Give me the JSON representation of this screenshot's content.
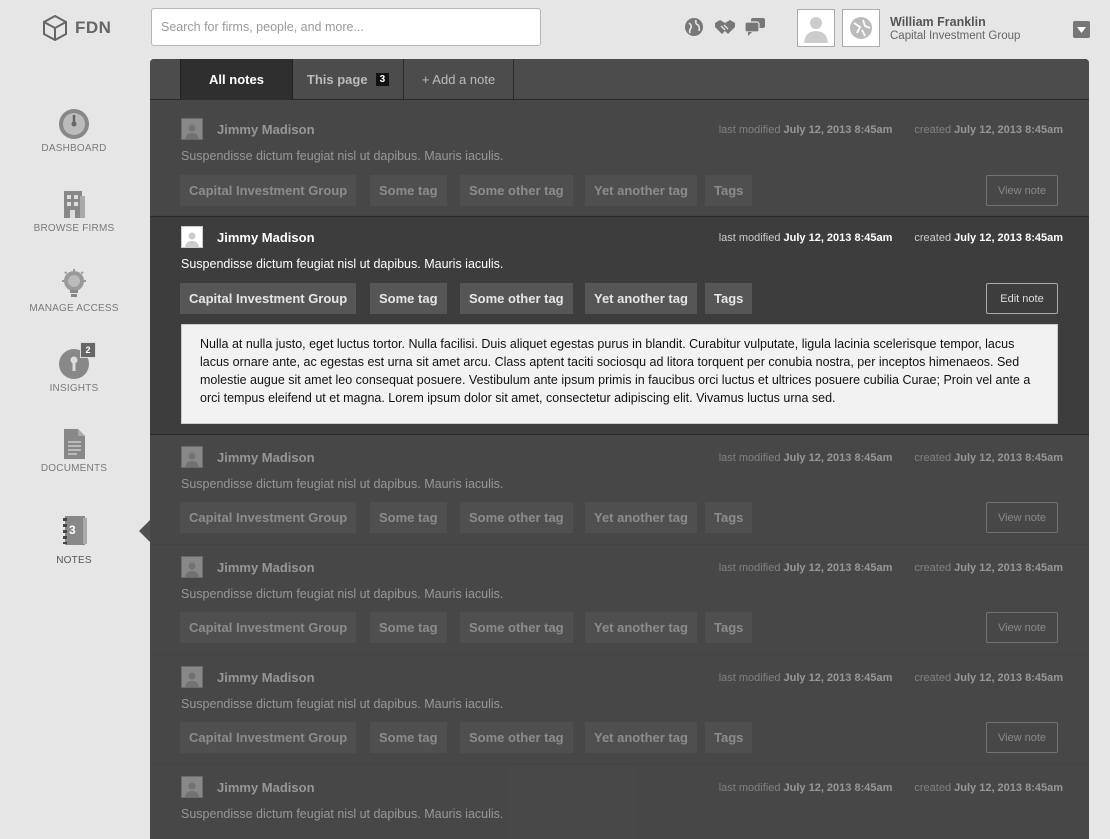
{
  "app": {
    "logo_text": "FDN"
  },
  "search": {
    "placeholder": "Search for firms, people, and more..."
  },
  "top_icons": [
    "globe-icon",
    "handshake-icon",
    "chat-icon"
  ],
  "user": {
    "name": "William Franklin",
    "organization": "Capital Investment Group"
  },
  "sidebar": {
    "items": [
      {
        "label": "DASHBOARD",
        "icon": "dashboard-icon"
      },
      {
        "label": "BROWSE FIRMS",
        "icon": "building-icon"
      },
      {
        "label": "MANAGE ACCESS",
        "icon": "lightbulb-icon"
      },
      {
        "label": "INSIGHTS",
        "icon": "insight-icon",
        "badge": "2"
      },
      {
        "label": "DOCUMENTS",
        "icon": "document-icon"
      },
      {
        "label": "NOTES",
        "icon": "notebook-icon",
        "badge": "3",
        "active": true
      }
    ]
  },
  "tabs": [
    {
      "label": "All notes",
      "active": true
    },
    {
      "label": "This page",
      "count": "3"
    },
    {
      "label": "+ Add a note"
    }
  ],
  "notes": [
    {
      "author": "Jimmy Madison",
      "modified_label": "last modified",
      "modified": "July 12, 2013 8:45am",
      "created_label": "created",
      "created": "July 12, 2013 8:45am",
      "summary": "Suspendisse dictum feugiat nisl ut dapibus. Mauris iaculis.",
      "tags": [
        "Capital Investment Group",
        "Some tag",
        "Some other tag",
        "Yet another tag",
        "Tags"
      ],
      "button": "View note"
    },
    {
      "author": "Jimmy Madison",
      "modified_label": "last modified",
      "modified": "July 12, 2013 8:45am",
      "created_label": "created",
      "created": "July 12, 2013 8:45am",
      "summary": "Suspendisse dictum feugiat nisl ut dapibus. Mauris iaculis.",
      "tags": [
        "Capital Investment Group",
        "Some tag",
        "Some other tag",
        "Yet another tag",
        "Tags"
      ],
      "button": "Edit note",
      "body": "Nulla at nulla justo, eget luctus tortor. Nulla facilisi. Duis aliquet egestas purus in blandit. Curabitur vulputate, ligula lacinia scelerisque tempor, lacus lacus ornare ante, ac egestas est urna sit amet arcu. Class aptent taciti sociosqu ad litora torquent per conubia nostra, per inceptos himenaeos. Sed molestie augue sit amet leo consequat posuere. Vestibulum ante ipsum primis in faucibus orci luctus et ultrices posuere cubilia Curae; Proin vel ante a orci tempus eleifend ut et magna. Lorem ipsum dolor sit amet, consectetur adipiscing elit. Vivamus luctus urna sed."
    },
    {
      "author": "Jimmy Madison",
      "modified_label": "last modified",
      "modified": "July 12, 2013 8:45am",
      "created_label": "created",
      "created": "July 12, 2013 8:45am",
      "summary": "Suspendisse dictum feugiat nisl ut dapibus. Mauris iaculis.",
      "tags": [
        "Capital Investment Group",
        "Some tag",
        "Some other tag",
        "Yet another tag",
        "Tags"
      ],
      "button": "View note"
    },
    {
      "author": "Jimmy Madison",
      "modified_label": "last modified",
      "modified": "July 12, 2013 8:45am",
      "created_label": "created",
      "created": "July 12, 2013 8:45am",
      "summary": "Suspendisse dictum feugiat nisl ut dapibus. Mauris iaculis.",
      "tags": [
        "Capital Investment Group",
        "Some tag",
        "Some other tag",
        "Yet another tag",
        "Tags"
      ],
      "button": "View note"
    },
    {
      "author": "Jimmy Madison",
      "modified_label": "last modified",
      "modified": "July 12, 2013 8:45am",
      "created_label": "created",
      "created": "July 12, 2013 8:45am",
      "summary": "Suspendisse dictum feugiat nisl ut dapibus. Mauris iaculis.",
      "tags": [
        "Capital Investment Group",
        "Some tag",
        "Some other tag",
        "Yet another tag",
        "Tags"
      ],
      "button": "View note"
    },
    {
      "author": "Jimmy Madison",
      "modified_label": "last modified",
      "modified": "July 12, 2013 8:45am",
      "created_label": "created",
      "created": "July 12, 2013 8:45am",
      "summary": "Suspendisse dictum feugiat nisl ut dapibus. Mauris iaculis."
    }
  ]
}
